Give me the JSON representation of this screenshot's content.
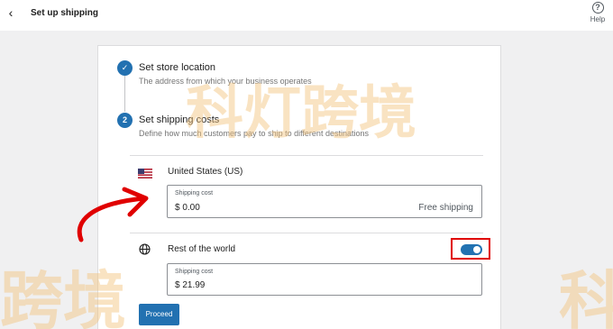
{
  "header": {
    "back_icon": "chevron-left-icon",
    "title": "Set up shipping",
    "help_label": "Help",
    "help_icon": "question-circle-icon"
  },
  "steps": [
    {
      "number": "✓",
      "state": "completed",
      "title": "Set store location",
      "description": "The address from which your business operates"
    },
    {
      "number": "2",
      "state": "active",
      "title": "Set shipping costs",
      "description": "Define how much customers pay to ship to different destinations"
    }
  ],
  "regions": [
    {
      "icon": "us-flag-icon",
      "name": "United States (US)",
      "field_label": "Shipping cost",
      "value": "$ 0.00",
      "hint": "Free shipping"
    },
    {
      "icon": "globe-icon",
      "name": "Rest of the world",
      "field_label": "Shipping cost",
      "value": "$ 21.99",
      "toggle_on": true
    }
  ],
  "proceed_label": "Proceed",
  "watermarks": {
    "center": "科灯跨境",
    "left": "跨境",
    "right": "科"
  },
  "colors": {
    "accent": "#2271b1",
    "highlight": "#e00000",
    "watermark": "#f3c27a"
  }
}
